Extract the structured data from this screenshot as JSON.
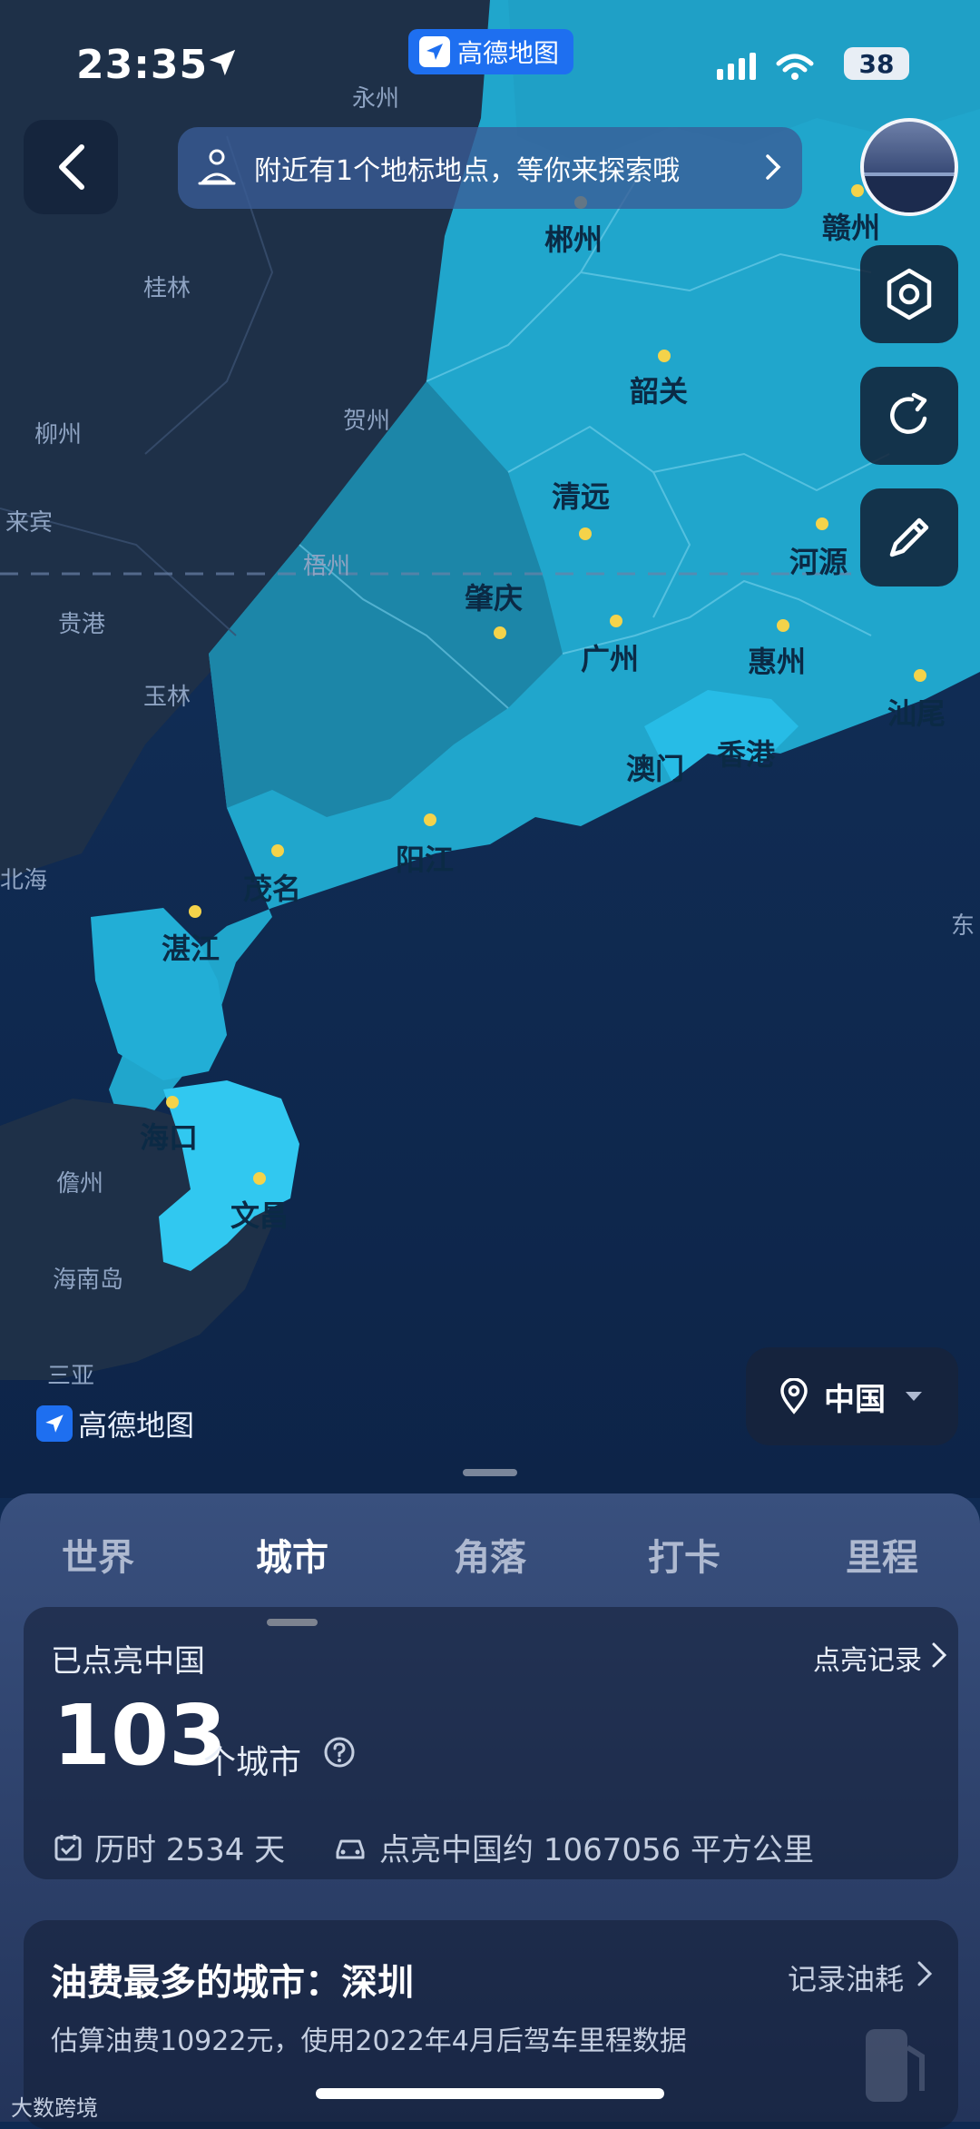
{
  "colors": {
    "sea": "#0f2a52",
    "unlit_land": "#1e3048",
    "lit_land": "#20a6cc",
    "lit_highlight": "#27bce6",
    "accent_blue": "#1e6ff0"
  },
  "status_bar": {
    "time": "23:35",
    "app_label": "高德地图",
    "battery": "38"
  },
  "banner": {
    "text": "附近有1个地标地点，等你来探索哦",
    "icon": "landmark-icon"
  },
  "map": {
    "dark_labels": [
      "永州",
      "桂林",
      "贺州",
      "柳州",
      "来宾",
      "梧州",
      "贵港",
      "玉林",
      "北海",
      "儋州",
      "海南岛",
      "三亚",
      "东"
    ],
    "lit_labels": [
      "郴州",
      "赣州",
      "韶关",
      "清远",
      "河源",
      "肇庆",
      "广州",
      "惠州",
      "汕尾",
      "香港",
      "澳门",
      "阳江",
      "茂名",
      "湛江",
      "海口",
      "文昌"
    ],
    "logo_text": "高德地图"
  },
  "region_selector": {
    "value": "中国"
  },
  "tabs": [
    {
      "label": "世界"
    },
    {
      "label": "城市"
    },
    {
      "label": "角落"
    },
    {
      "label": "打卡"
    },
    {
      "label": "里程"
    }
  ],
  "card_summary": {
    "title": "已点亮中国",
    "link": "点亮记录",
    "count": "103",
    "unit": "个城市",
    "duration": "历时 2534 天",
    "area": "点亮中国约 1067056 平方公里"
  },
  "card_fuel": {
    "title": "油费最多的城市：深圳",
    "link": "记录油耗",
    "desc": "估算油费10922元，使用2022年4月后驾车里程数据"
  },
  "watermark": "大数跨境"
}
